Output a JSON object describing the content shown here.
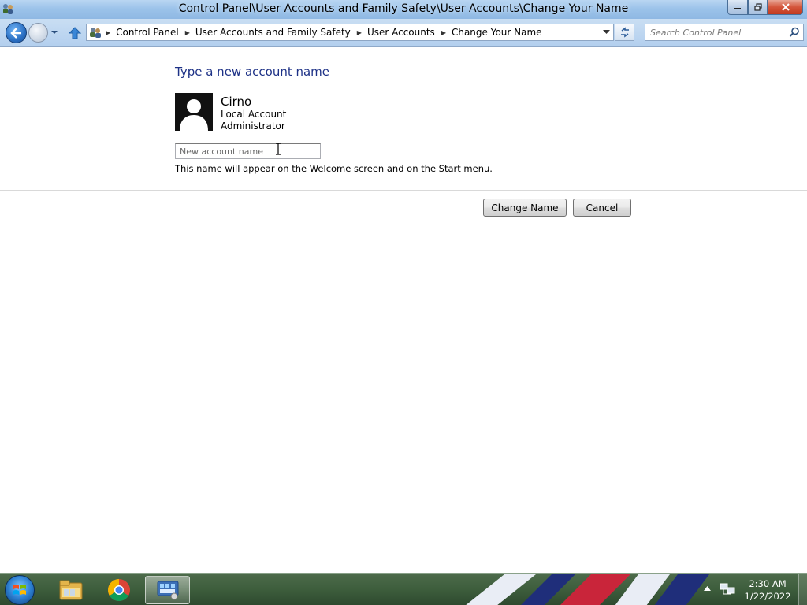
{
  "window": {
    "title": "Control Panel\\User Accounts and Family Safety\\User Accounts\\Change Your Name"
  },
  "address_bar": {
    "breadcrumbs": [
      "Control Panel",
      "User Accounts and Family Safety",
      "User Accounts",
      "Change Your Name"
    ]
  },
  "search": {
    "placeholder": "Search Control Panel"
  },
  "main": {
    "heading": "Type a new account name",
    "account": {
      "name": "Cirno",
      "type": "Local Account",
      "role": "Administrator"
    },
    "name_input": {
      "placeholder": "New account name",
      "value": ""
    },
    "hint": "This name will appear on the Welcome screen and on the Start menu.",
    "buttons": {
      "change_name": "Change Name",
      "cancel": "Cancel"
    }
  },
  "taskbar": {
    "pinned": [
      "windows-explorer-icon",
      "chrome-icon",
      "control-panel-icon"
    ],
    "clock": {
      "time": "2:30 AM",
      "date": "1/22/2022"
    }
  },
  "colors": {
    "heading": "#1e3287",
    "titlebar": "#9cc3ea",
    "taskbar": "#3d5d3c"
  }
}
